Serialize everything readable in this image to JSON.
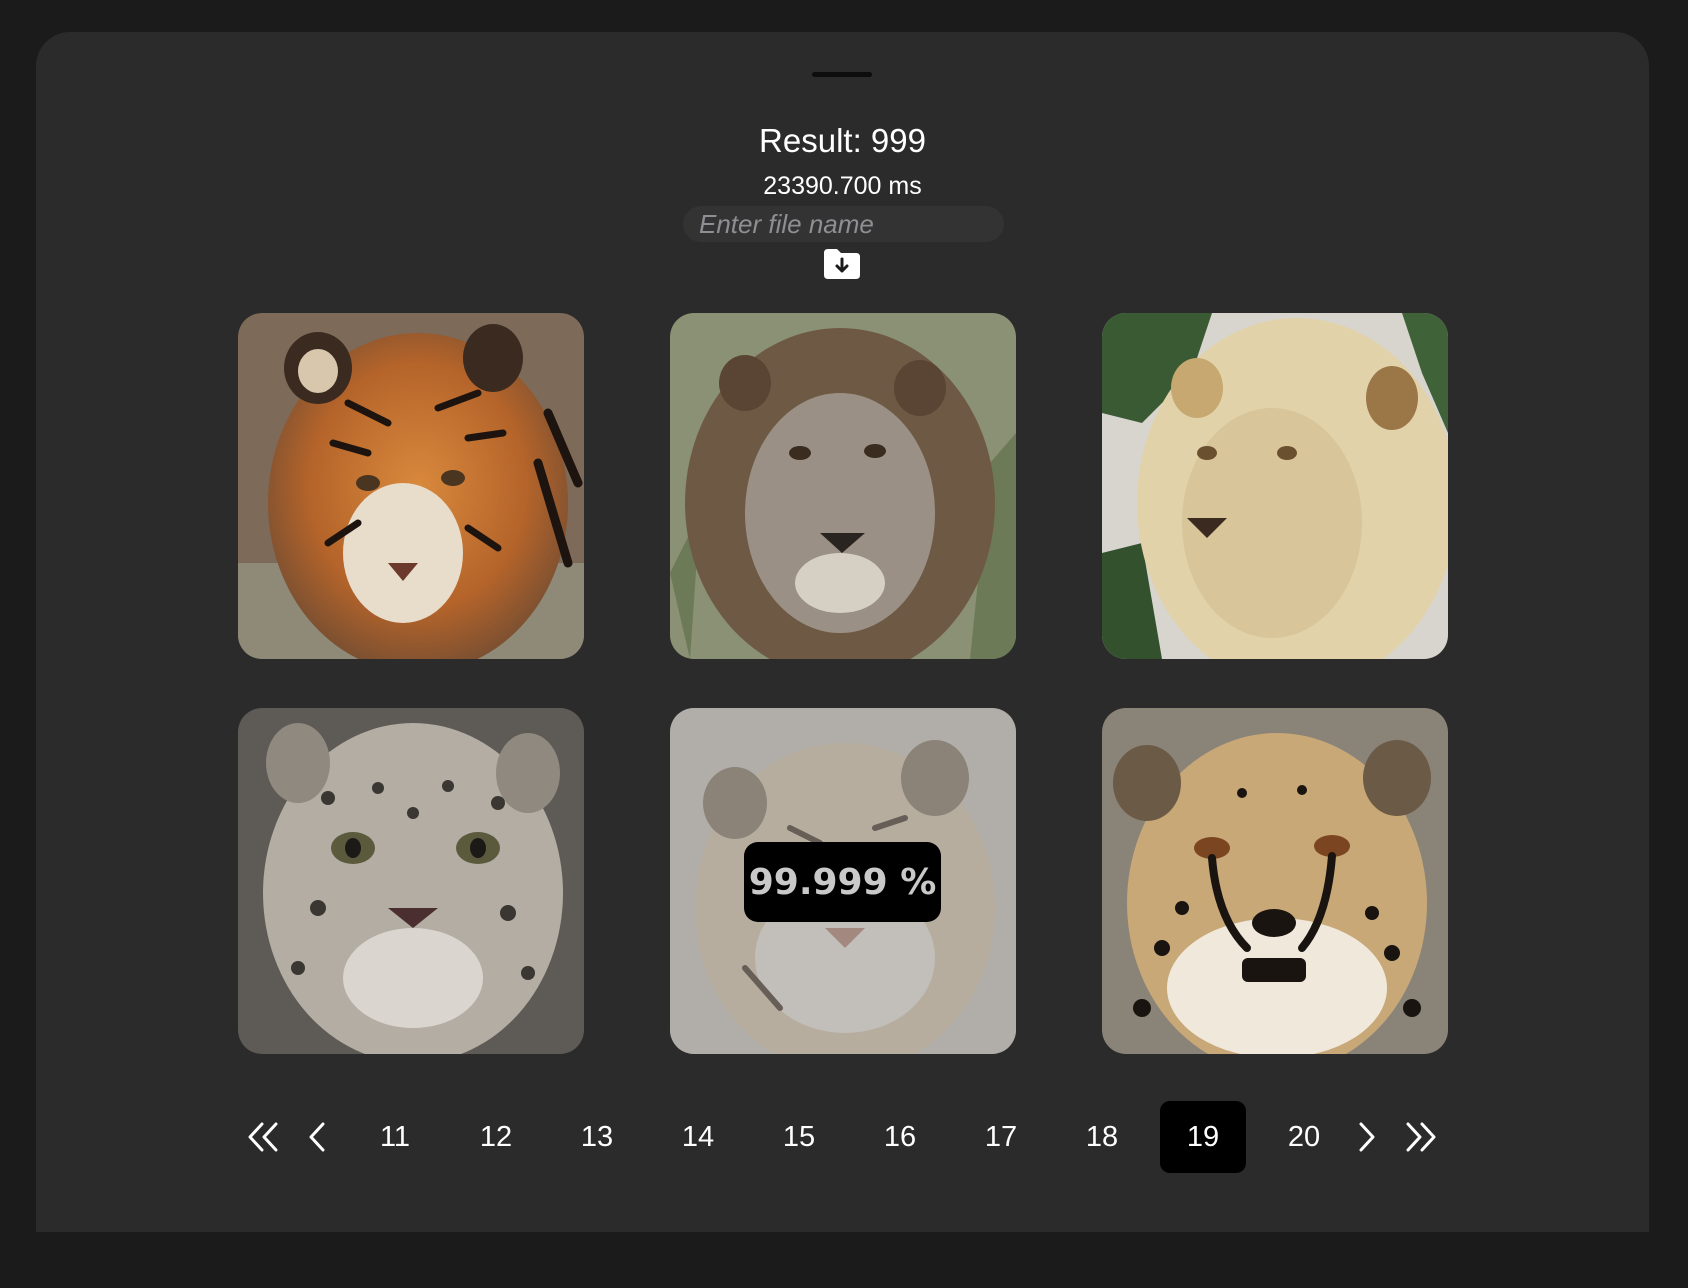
{
  "header": {
    "result_label": "Result: 999",
    "timing_label": "23390.700 ms"
  },
  "filename": {
    "placeholder": "Enter file name",
    "value": ""
  },
  "save_icon": "folder-download-icon",
  "gallery": {
    "tiles": [
      {
        "subject": "tiger",
        "icon": "tiger-photo"
      },
      {
        "subject": "lion",
        "icon": "lion-photo"
      },
      {
        "subject": "white lion",
        "icon": "white-lion-photo"
      },
      {
        "subject": "snow leopard",
        "icon": "snow-leopard-photo"
      },
      {
        "subject": "white tiger",
        "icon": "white-tiger-photo",
        "selected": true,
        "confidence_label": "99.999 %"
      },
      {
        "subject": "cheetah",
        "icon": "cheetah-photo"
      }
    ]
  },
  "pagination": {
    "first_icon": "double-chevron-left-icon",
    "prev_icon": "chevron-left-icon",
    "next_icon": "chevron-right-icon",
    "last_icon": "double-chevron-right-icon",
    "pages": [
      "11",
      "12",
      "13",
      "14",
      "15",
      "16",
      "17",
      "18",
      "19",
      "20"
    ],
    "current_page": "19"
  },
  "colors": {
    "background": "#1b1b1b",
    "sheet": "#2b2b2b",
    "active_page": "#000000"
  }
}
